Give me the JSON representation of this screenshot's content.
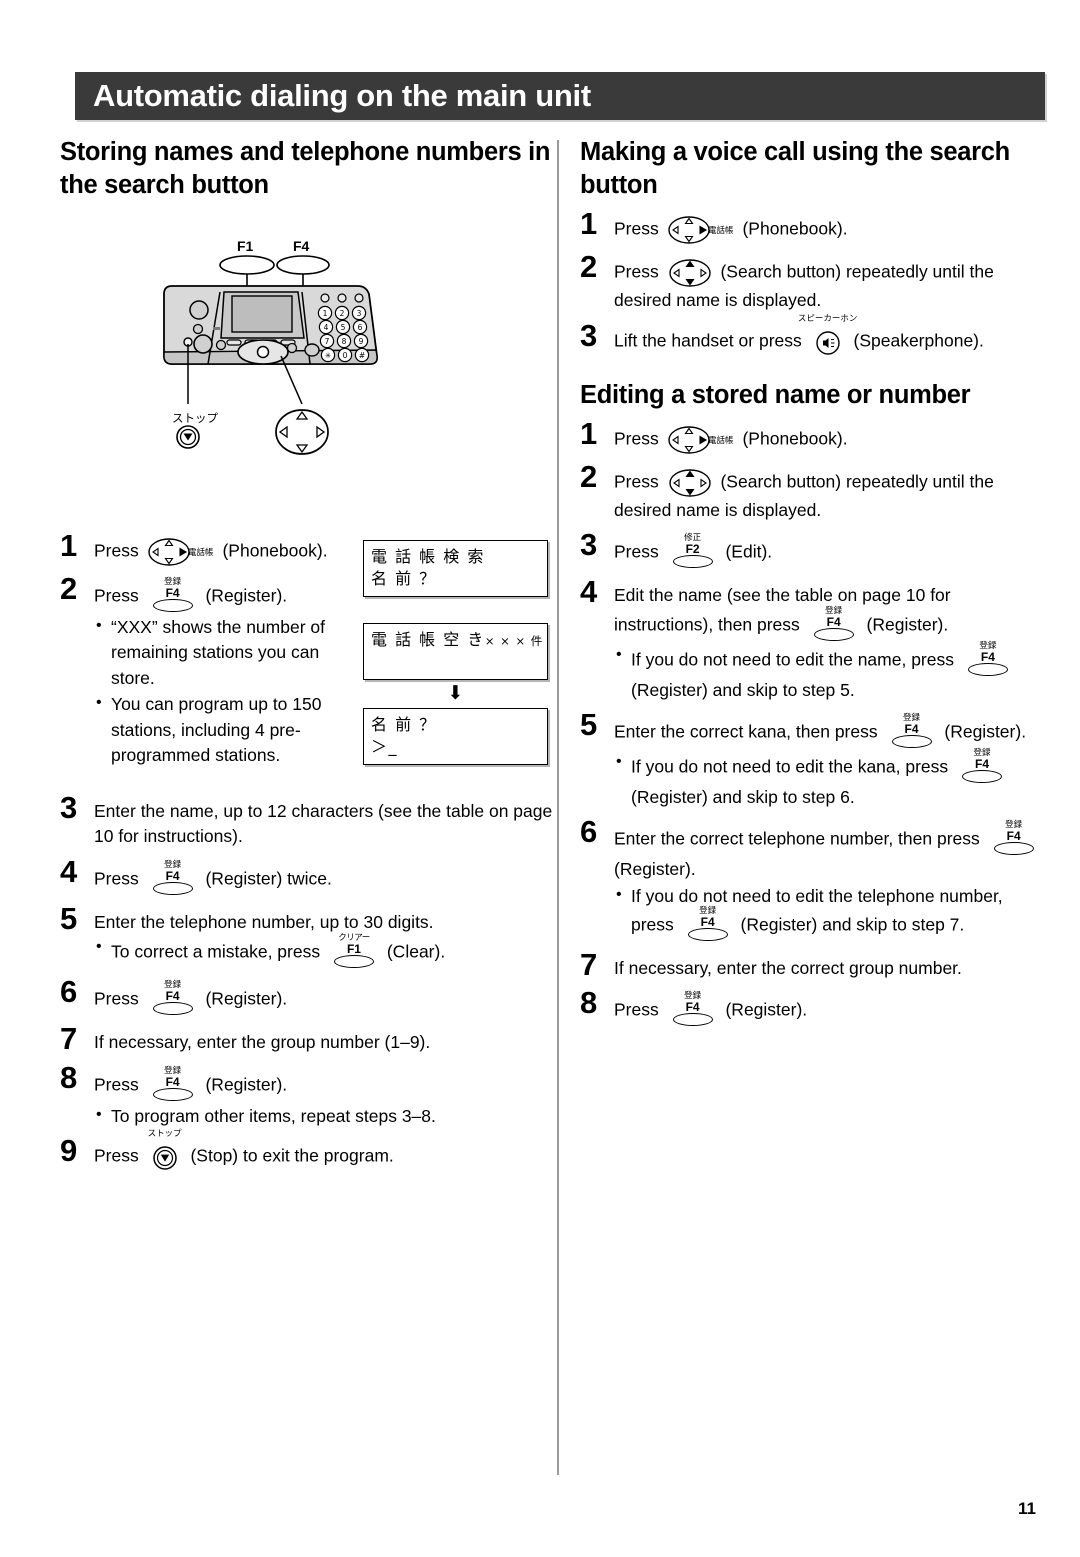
{
  "header": {
    "title": "Automatic dialing on the main unit"
  },
  "page_number": "11",
  "left": {
    "section_title": "Storing names and telephone numbers in the search button",
    "illustration": {
      "label_f1": "F1",
      "label_f4": "F4",
      "label_stop": "ストップ",
      "keypad": [
        "1",
        "2",
        "3",
        "4",
        "5",
        "6",
        "7",
        "8",
        "9",
        "∗",
        "0",
        "#"
      ]
    },
    "steps": [
      {
        "num": "1",
        "before": "Press",
        "key": {
          "type": "phonebook",
          "jp": "電話帳"
        },
        "after": "(Phonebook)."
      },
      {
        "num": "2",
        "before": "Press",
        "key": {
          "type": "fkey",
          "jp": "登録",
          "fn": "F4"
        },
        "after": "(Register).",
        "bullets": [
          "“XXX” shows the number of remaining stations you can store.",
          "You can program up to 150 stations, including 4 pre-programmed stations."
        ]
      },
      {
        "num": "3",
        "before": "Enter the name, up to 12 characters (see the table on page 10 for instructions).",
        "after": ""
      },
      {
        "num": "4",
        "before": "Press",
        "key": {
          "type": "fkey",
          "jp": "登録",
          "fn": "F4"
        },
        "after": "(Register) twice."
      },
      {
        "num": "5",
        "before": "Enter the telephone number, up to 30 digits.",
        "after": "",
        "bullet_rich": {
          "before": "To correct a mistake, press",
          "key": {
            "type": "fkey",
            "jp": "クリアー",
            "fn": "F1"
          },
          "after": "(Clear)."
        }
      },
      {
        "num": "6",
        "before": "Press",
        "key": {
          "type": "fkey",
          "jp": "登録",
          "fn": "F4"
        },
        "after": "(Register)."
      },
      {
        "num": "7",
        "before": "If necessary, enter the group number (1–9).",
        "after": ""
      },
      {
        "num": "8",
        "before": "Press",
        "key": {
          "type": "fkey",
          "jp": "登録",
          "fn": "F4"
        },
        "after": "(Register).",
        "bullets": [
          "To program other items, repeat steps 3–8."
        ]
      },
      {
        "num": "9",
        "before": "Press",
        "key": {
          "type": "stop",
          "jp": "ストップ"
        },
        "after": "(Stop) to exit the program."
      }
    ],
    "lcd_screens": [
      {
        "lines": [
          "電 話 帳 検 索",
          "名 前 ？"
        ]
      },
      {
        "lines": [
          "電 話 帳 空 き",
          ""
        ],
        "small_suffix": "× × × 件"
      },
      {
        "arrow": "⬇"
      },
      {
        "lines": [
          "名 前 ？",
          "＞_"
        ]
      }
    ]
  },
  "right": {
    "section1_title": "Making a voice call using the search button",
    "section1_steps": [
      {
        "num": "1",
        "before": "Press",
        "key": {
          "type": "phonebook",
          "jp": "電話帳"
        },
        "after": "(Phonebook)."
      },
      {
        "num": "2",
        "before": "Press",
        "key": {
          "type": "search"
        },
        "after": "(Search button) repeatedly until the desired name is displayed."
      },
      {
        "num": "3",
        "before": "Lift the handset or press",
        "key": {
          "type": "speakerphone",
          "jp": "スピーカーホン"
        },
        "after": "(Speakerphone)."
      }
    ],
    "section2_title": "Editing a stored name or number",
    "section2_steps": [
      {
        "num": "1",
        "before": "Press",
        "key": {
          "type": "phonebook",
          "jp": "電話帳"
        },
        "after": "(Phonebook)."
      },
      {
        "num": "2",
        "before": "Press",
        "key": {
          "type": "search"
        },
        "after": "(Search button) repeatedly until the desired name is displayed."
      },
      {
        "num": "3",
        "before": "Press",
        "key": {
          "type": "fkey",
          "jp": "修正",
          "fn": "F2"
        },
        "after": "(Edit)."
      },
      {
        "num": "4",
        "before": "Edit the name (see the table on page 10 for instructions), then press",
        "key": {
          "type": "fkey",
          "jp": "登録",
          "fn": "F4"
        },
        "after": "(Register).",
        "bullet_rich": {
          "before": "If you do not need to edit the name, press",
          "key": {
            "type": "fkey",
            "jp": "登録",
            "fn": "F4"
          },
          "after": "(Register) and skip to step 5."
        }
      },
      {
        "num": "5",
        "before": "Enter the correct kana, then press",
        "key": {
          "type": "fkey",
          "jp": "登録",
          "fn": "F4"
        },
        "after": "(Register).",
        "bullet_rich": {
          "before": "If you do not need to edit the kana, press",
          "key": {
            "type": "fkey",
            "jp": "登録",
            "fn": "F4"
          },
          "after": "(Register) and skip to step 6."
        }
      },
      {
        "num": "6",
        "before": "Enter the correct telephone number, then press",
        "key": {
          "type": "fkey",
          "jp": "登録",
          "fn": "F4"
        },
        "after": "(Register).",
        "bullet_rich": {
          "before": "If you do not need to edit the telephone number, press",
          "key": {
            "type": "fkey",
            "jp": "登録",
            "fn": "F4"
          },
          "after": "(Register) and skip to step 7."
        }
      },
      {
        "num": "7",
        "before": "If necessary, enter the correct group number.",
        "after": ""
      },
      {
        "num": "8",
        "before": "Press",
        "key": {
          "type": "fkey",
          "jp": "登録",
          "fn": "F4"
        },
        "after": "(Register)."
      }
    ]
  }
}
